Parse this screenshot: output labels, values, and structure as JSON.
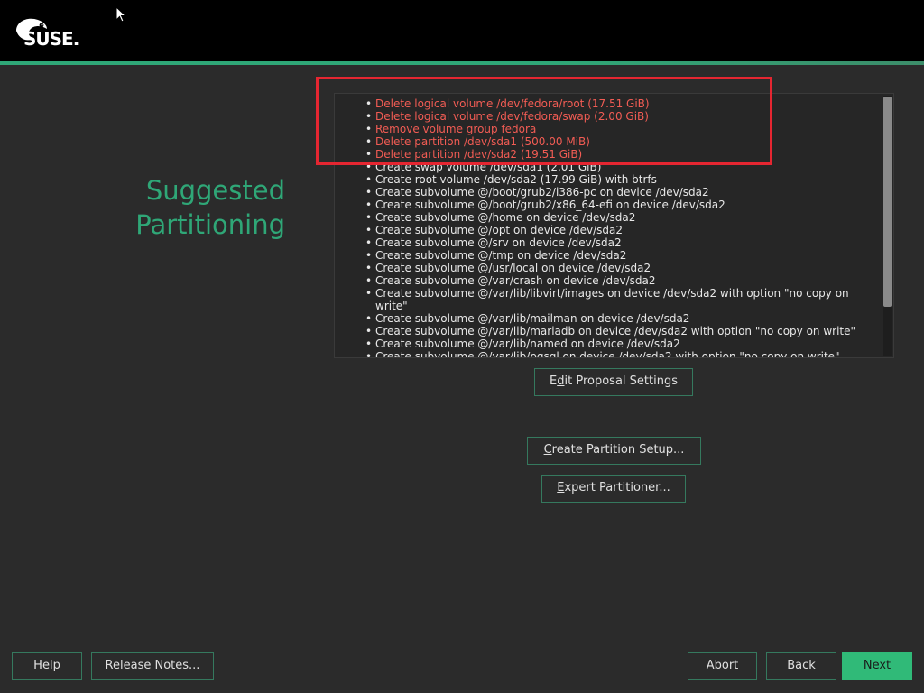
{
  "header": {
    "logo_text": "SUSE",
    "accent_color": "#2fa777"
  },
  "title": {
    "line1": "Suggested",
    "line2": "Partitioning"
  },
  "summary": {
    "items": [
      {
        "text": "Delete logical volume /dev/fedora/root (17.51 GiB)",
        "type": "delete"
      },
      {
        "text": "Delete logical volume /dev/fedora/swap (2.00 GiB)",
        "type": "delete"
      },
      {
        "text": "Remove volume group fedora",
        "type": "delete"
      },
      {
        "text": "Delete partition /dev/sda1 (500.00 MiB)",
        "type": "delete"
      },
      {
        "text": "Delete partition /dev/sda2 (19.51 GiB)",
        "type": "delete"
      },
      {
        "text": "Create swap volume /dev/sda1 (2.01 GiB)",
        "type": "create"
      },
      {
        "text": "Create root volume /dev/sda2 (17.99 GiB) with btrfs",
        "type": "create"
      },
      {
        "text": "Create subvolume @/boot/grub2/i386-pc on device /dev/sda2",
        "type": "create"
      },
      {
        "text": "Create subvolume @/boot/grub2/x86_64-efi on device /dev/sda2",
        "type": "create"
      },
      {
        "text": "Create subvolume @/home on device /dev/sda2",
        "type": "create"
      },
      {
        "text": "Create subvolume @/opt on device /dev/sda2",
        "type": "create"
      },
      {
        "text": "Create subvolume @/srv on device /dev/sda2",
        "type": "create"
      },
      {
        "text": "Create subvolume @/tmp on device /dev/sda2",
        "type": "create"
      },
      {
        "text": "Create subvolume @/usr/local on device /dev/sda2",
        "type": "create"
      },
      {
        "text": "Create subvolume @/var/crash on device /dev/sda2",
        "type": "create"
      },
      {
        "text": "Create subvolume @/var/lib/libvirt/images on device /dev/sda2 with option \"no copy on write\"",
        "type": "create"
      },
      {
        "text": "Create subvolume @/var/lib/mailman on device /dev/sda2",
        "type": "create"
      },
      {
        "text": "Create subvolume @/var/lib/mariadb on device /dev/sda2 with option \"no copy on write\"",
        "type": "create"
      },
      {
        "text": "Create subvolume @/var/lib/named on device /dev/sda2",
        "type": "create"
      },
      {
        "text": "Create subvolume @/var/lib/pgsql on device /dev/sda2 with option \"no copy on write\"",
        "type": "create"
      }
    ],
    "delete_color": "#f25c54",
    "highlight_color": "#e52631"
  },
  "buttons": {
    "edit_proposal": {
      "pre": "E",
      "u": "d",
      "post": "it Proposal Settings"
    },
    "create_setup": {
      "pre": "",
      "u": "C",
      "post": "reate Partition Setup..."
    },
    "expert": {
      "pre": "",
      "u": "E",
      "post": "xpert Partitioner..."
    },
    "help": {
      "pre": "",
      "u": "H",
      "post": "elp"
    },
    "release_notes": {
      "pre": "Re",
      "u": "l",
      "post": "ease Notes..."
    },
    "abort": {
      "pre": "Abor",
      "u": "t",
      "post": ""
    },
    "back": {
      "pre": "",
      "u": "B",
      "post": "ack"
    },
    "next": {
      "pre": "",
      "u": "N",
      "post": "ext"
    }
  },
  "icons": {
    "logo": "suse-chameleon-icon",
    "cursor": "mouse-pointer-icon"
  }
}
